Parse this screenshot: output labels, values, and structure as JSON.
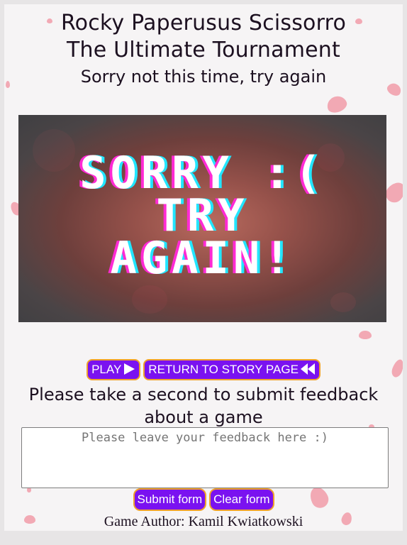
{
  "header": {
    "title_line1": "Rocky Paperusus Scissorro",
    "title_line2": "The Ultimate Tournament",
    "subtitle": "Sorry not this time, try again"
  },
  "banner": {
    "line1": "SORRY :(",
    "line2": "TRY",
    "line3": "AGAIN!"
  },
  "actions": {
    "play_label": "PLAY",
    "play_icon": "play-icon",
    "return_label": "RETURN TO STORY PAGE",
    "return_icon": "rewind-icon"
  },
  "feedback": {
    "prompt": "Please take a second to submit feedback about a game",
    "placeholder": "Please leave your feedback here :)",
    "value": "",
    "submit_label": "Submit form",
    "clear_label": "Clear form"
  },
  "footer": {
    "author": "Game Author: Kamil Kwiatkowski"
  },
  "colors": {
    "button_bg": "#7a12f0",
    "button_border": "#f0a22a",
    "petal": "#f2a9b4",
    "glitch_pink": "#ff2ad4",
    "glitch_cyan": "#22e6ff"
  }
}
